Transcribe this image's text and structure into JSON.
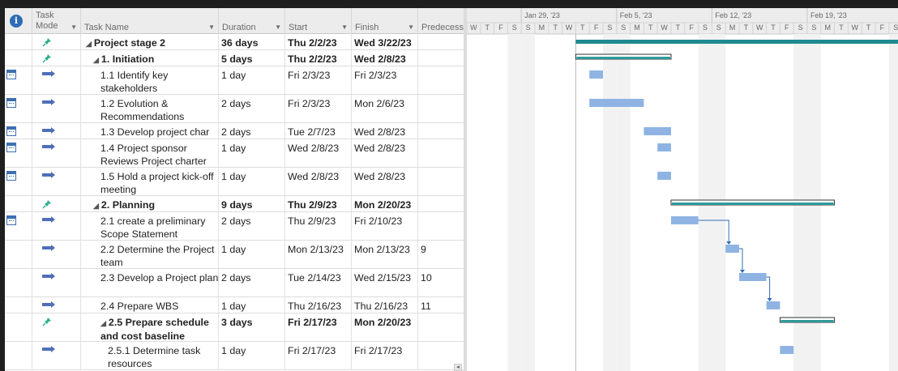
{
  "columns": {
    "indicators_icon": "info-icon",
    "task_mode_label": "Task Mode",
    "task_name_label": "Task Name",
    "duration_label": "Duration",
    "start_label": "Start",
    "finish_label": "Finish",
    "predecessors_label": "Predecesso"
  },
  "timeline": {
    "weeks": [
      "Jan 29, '23",
      "Feb 5, '23",
      "Feb 12, '23",
      "Feb 19, '23"
    ],
    "days": [
      "W",
      "T",
      "F",
      "S",
      "S",
      "M",
      "T",
      "W",
      "T",
      "F",
      "S",
      "S",
      "M",
      "T",
      "W",
      "T",
      "F",
      "S",
      "S",
      "M",
      "T",
      "W",
      "T",
      "F",
      "S",
      "S",
      "M",
      "T",
      "W",
      "T",
      "F",
      "S"
    ]
  },
  "tasks": [
    {
      "name": "Project stage 2",
      "duration": "36 days",
      "start": "Thu 2/2/23",
      "finish": "Wed 3/22/23",
      "pred": "",
      "level": 0,
      "summary": true,
      "mode": "manual",
      "calendar": false,
      "bar": {
        "start": 8,
        "end": 50,
        "kind": "project"
      }
    },
    {
      "name": "1. Initiation",
      "duration": "5 days",
      "start": "Thu 2/2/23",
      "finish": "Wed 2/8/23",
      "pred": "",
      "level": 1,
      "summary": true,
      "mode": "manual",
      "calendar": false,
      "bar": {
        "start": 8,
        "end": 15,
        "kind": "summary"
      }
    },
    {
      "name": "1.1 Identify key stakeholders",
      "duration": "1 day",
      "start": "Fri 2/3/23",
      "finish": "Fri 2/3/23",
      "pred": "",
      "level": 2,
      "summary": false,
      "mode": "auto",
      "calendar": true,
      "bar": {
        "start": 9,
        "end": 10,
        "kind": "task"
      }
    },
    {
      "name": "1.2 Evolution & Recommendations",
      "duration": "2 days",
      "start": "Fri 2/3/23",
      "finish": "Mon 2/6/23",
      "pred": "",
      "level": 2,
      "summary": false,
      "mode": "auto",
      "calendar": true,
      "bar": {
        "start": 9,
        "end": 13,
        "kind": "task"
      }
    },
    {
      "name": "1.3 Develop project char",
      "duration": "2 days",
      "start": "Tue 2/7/23",
      "finish": "Wed 2/8/23",
      "pred": "",
      "level": 2,
      "summary": false,
      "mode": "auto",
      "calendar": true,
      "bar": {
        "start": 13,
        "end": 15,
        "kind": "task"
      }
    },
    {
      "name": "1.4 Project sponsor Reviews Project charter",
      "duration": "1 day",
      "start": "Wed 2/8/23",
      "finish": "Wed 2/8/23",
      "pred": "",
      "level": 2,
      "summary": false,
      "mode": "auto",
      "calendar": true,
      "bar": {
        "start": 14,
        "end": 15,
        "kind": "task"
      }
    },
    {
      "name": "1.5 Hold a project kick-off meeting",
      "duration": "1 day",
      "start": "Wed 2/8/23",
      "finish": "Wed 2/8/23",
      "pred": "",
      "level": 2,
      "summary": false,
      "mode": "auto",
      "calendar": true,
      "bar": {
        "start": 14,
        "end": 15,
        "kind": "task"
      }
    },
    {
      "name": "2. Planning",
      "duration": "9 days",
      "start": "Thu 2/9/23",
      "finish": "Mon 2/20/23",
      "pred": "",
      "level": 1,
      "summary": true,
      "mode": "manual",
      "calendar": false,
      "bar": {
        "start": 15,
        "end": 27,
        "kind": "summary"
      }
    },
    {
      "name": "2.1 create a preliminary Scope Statement",
      "duration": "2 days",
      "start": "Thu 2/9/23",
      "finish": "Fri 2/10/23",
      "pred": "",
      "level": 2,
      "summary": false,
      "mode": "auto",
      "calendar": true,
      "bar": {
        "start": 15,
        "end": 17,
        "kind": "task"
      }
    },
    {
      "name": "2.2 Determine the Project team",
      "duration": "1 day",
      "start": "Mon 2/13/23",
      "finish": "Mon 2/13/23",
      "pred": "9",
      "level": 2,
      "summary": false,
      "mode": "auto",
      "calendar": false,
      "bar": {
        "start": 19,
        "end": 20,
        "kind": "task"
      }
    },
    {
      "name": "2.3 Develop a Project plan",
      "duration": "2 days",
      "start": "Tue 2/14/23",
      "finish": "Wed 2/15/23",
      "pred": "10",
      "level": 2,
      "summary": false,
      "mode": "auto",
      "calendar": false,
      "bar": {
        "start": 20,
        "end": 22,
        "kind": "task"
      }
    },
    {
      "name": "2.4 Prepare WBS",
      "duration": "1 day",
      "start": "Thu 2/16/23",
      "finish": "Thu 2/16/23",
      "pred": "11",
      "level": 2,
      "summary": false,
      "mode": "auto",
      "calendar": false,
      "bar": {
        "start": 22,
        "end": 23,
        "kind": "task"
      }
    },
    {
      "name": "2.5 Prepare schedule and cost baseline",
      "duration": "3 days",
      "start": "Fri 2/17/23",
      "finish": "Mon 2/20/23",
      "pred": "",
      "level": 2,
      "summary": true,
      "mode": "manual",
      "calendar": false,
      "bar": {
        "start": 23,
        "end": 27,
        "kind": "summary"
      }
    },
    {
      "name": "2.5.1 Determine task resources",
      "duration": "1 day",
      "start": "Fri 2/17/23",
      "finish": "Fri 2/17/23",
      "pred": "",
      "level": 3,
      "summary": false,
      "mode": "auto",
      "calendar": false,
      "bar": {
        "start": 23,
        "end": 24,
        "kind": "task"
      }
    }
  ],
  "links": [
    [
      8,
      9
    ],
    [
      9,
      10
    ],
    [
      10,
      11
    ]
  ],
  "colors": {
    "task_bar": "#8fb4e3",
    "summary_bar": "#2e9a9a",
    "project_bar": "#1f8a8f",
    "link": "#2e6db6",
    "weekend": "#f2f2f2",
    "pin": "#2fae8e",
    "auto": "#4f6fb8"
  }
}
